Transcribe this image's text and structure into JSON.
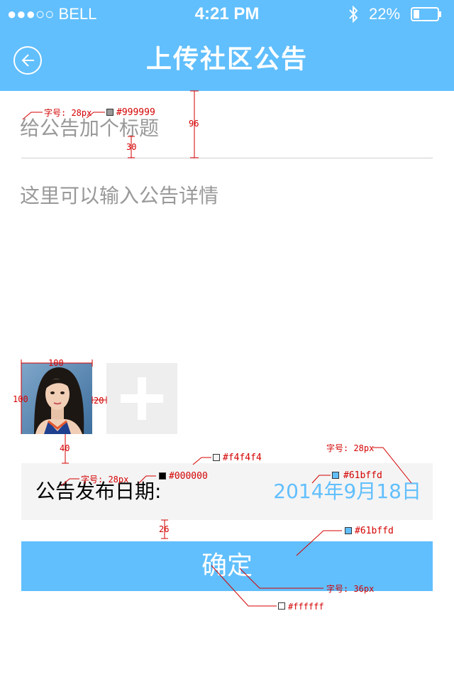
{
  "status_bar": {
    "carrier": "●●●○○ BELL",
    "time": "4:21 PM",
    "battery": "22%"
  },
  "nav": {
    "title": "上传社区公告"
  },
  "form": {
    "title_placeholder": "给公告加个标题",
    "detail_placeholder": "这里可以输入公告详情",
    "date_label": "公告发布日期:",
    "date_value": "2014年9月18日",
    "confirm_label": "确定"
  },
  "colors": {
    "primary": "#61bffd",
    "placeholder": "#999999",
    "date_row_bg": "#f4f4f4",
    "label_text": "#000000",
    "button_text": "#ffffff"
  },
  "annotations": {
    "font_size_28": "字号: 28px",
    "font_size_36": "字号: 36px",
    "color_999999": "#999999",
    "color_f4f4f4": "#f4f4f4",
    "color_000000": "#000000",
    "color_61bffd_a": "#61bffd",
    "color_61bffd_b": "#61bffd",
    "color_ffffff": "#ffffff",
    "dim_96": "96",
    "dim_30": "30",
    "dim_100_w": "100",
    "dim_100_h": "100",
    "dim_20": "20",
    "dim_40": "40",
    "dim_26": "26"
  }
}
